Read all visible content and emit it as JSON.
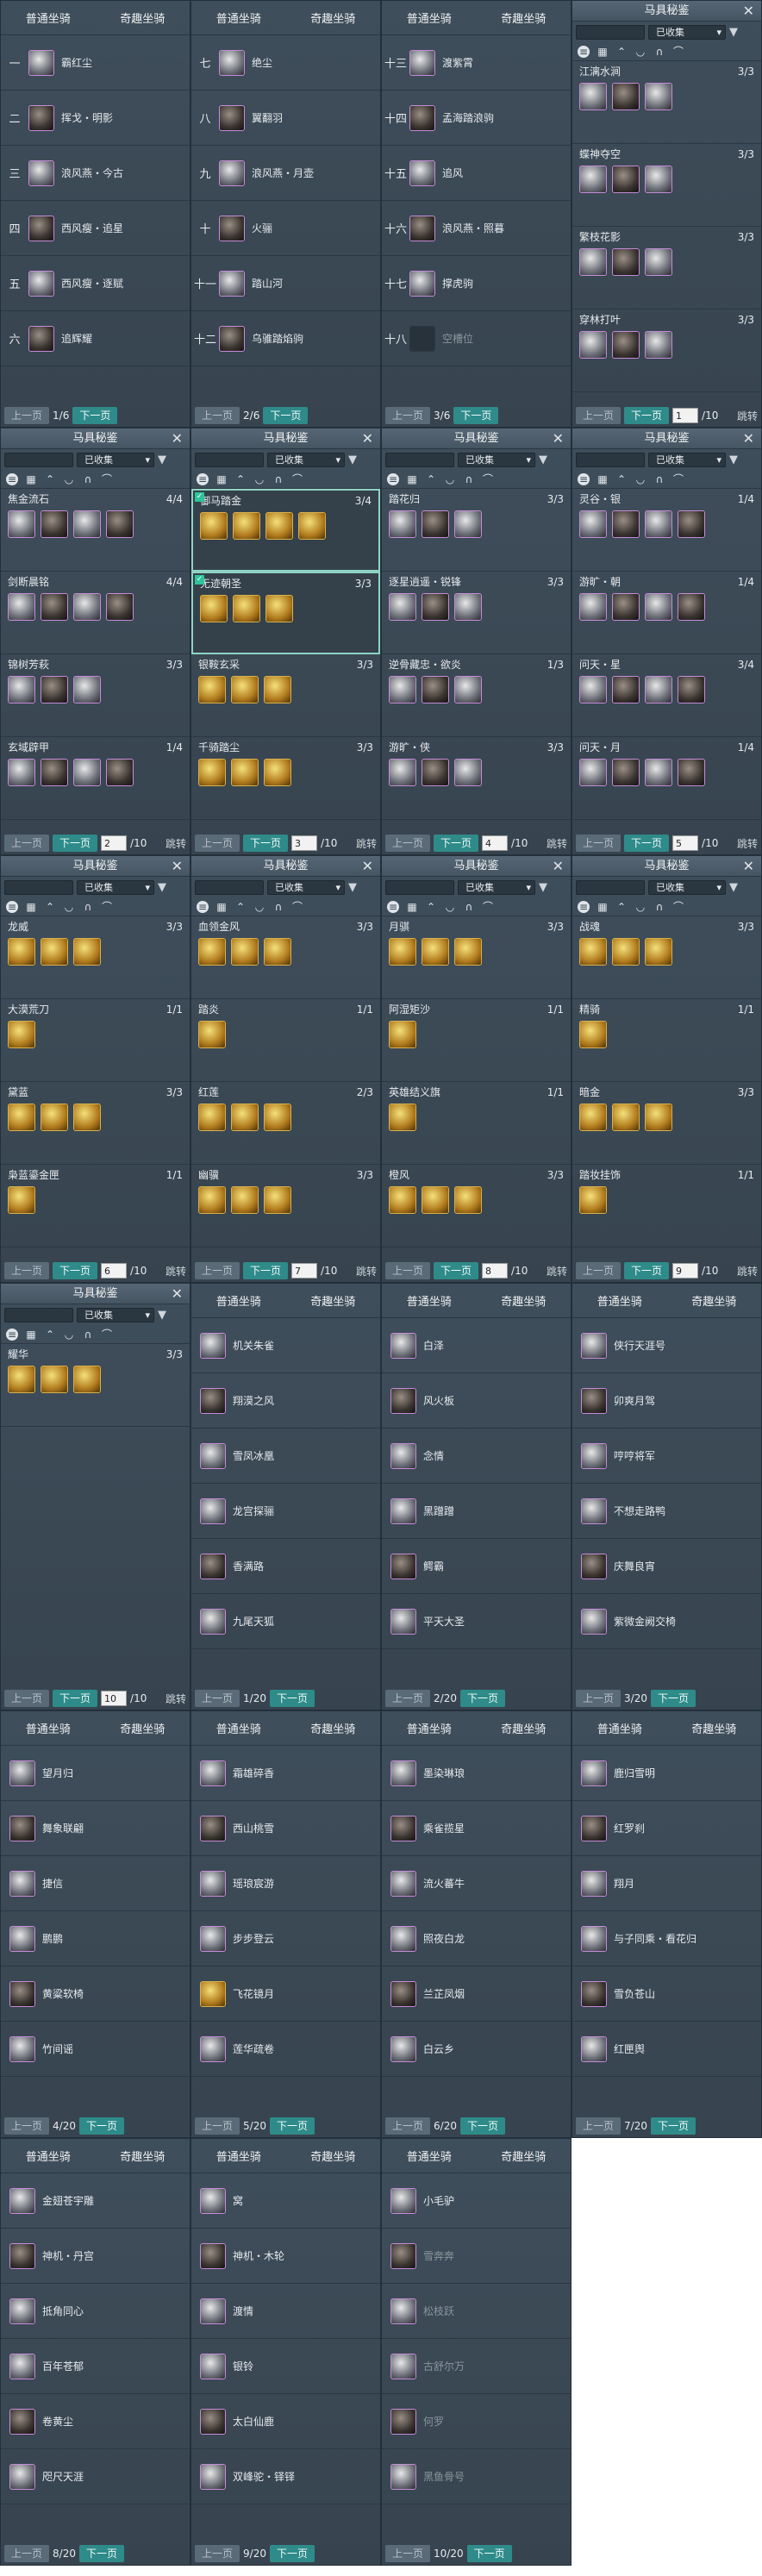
{
  "tabs": {
    "normal": "普通坐骑",
    "fun": "奇趣坐骑"
  },
  "btn": {
    "prev": "上一页",
    "next": "下一页",
    "jump": "跳转"
  },
  "gear": {
    "title": "马具秘鉴",
    "filter": "已收集"
  },
  "mounts": [
    {
      "page": "1/6",
      "rows": [
        [
          "一",
          "霸红尘"
        ],
        [
          "二",
          "挥戈・明影"
        ],
        [
          "三",
          "浪风燕・今古"
        ],
        [
          "四",
          "西风瘦・追星"
        ],
        [
          "五",
          "西风瘦・逐赋"
        ],
        [
          "六",
          "追辉耀"
        ]
      ]
    },
    {
      "page": "2/6",
      "rows": [
        [
          "七",
          "绝尘"
        ],
        [
          "八",
          "翼翻羽"
        ],
        [
          "九",
          "浪风燕・月壶"
        ],
        [
          "十",
          "火骊"
        ],
        [
          "十一",
          "踏山河"
        ],
        [
          "十二",
          "乌骓踏焰驹"
        ]
      ]
    },
    {
      "page": "3/6",
      "rows": [
        [
          "十三",
          "渡紫霄"
        ],
        [
          "十四",
          "孟海踏浪驹"
        ],
        [
          "十五",
          "追风"
        ],
        [
          "十六",
          "浪风燕・照暮"
        ],
        [
          "十七",
          "撑虎驹"
        ],
        [
          "十八",
          "空槽位"
        ]
      ]
    }
  ],
  "gearpanels": [
    {
      "page": "1",
      "items": [
        [
          "江漓水涧",
          "3/3",
          3
        ],
        [
          "蝶神夺空",
          "3/3",
          3
        ],
        [
          "繁枝花影",
          "3/3",
          3
        ],
        [
          "穿林打叶",
          "3/3",
          3
        ]
      ]
    },
    {
      "page": "2",
      "items": [
        [
          "焦金流石",
          "4/4",
          4
        ],
        [
          "剑断晨铭",
          "4/4",
          4
        ],
        [
          "锦树芳萩",
          "3/3",
          3
        ],
        [
          "玄域辟甲",
          "1/4",
          4
        ]
      ]
    },
    {
      "page": "3",
      "items": [
        [
          "御马踏金",
          "3/4",
          4
        ],
        [
          "无迹朝圣",
          "3/3",
          3
        ],
        [
          "银鞍玄采",
          "3/3",
          3
        ],
        [
          "千骑踏尘",
          "3/3",
          3
        ]
      ]
    },
    {
      "page": "4",
      "items": [
        [
          "踏花归",
          "3/3",
          3
        ],
        [
          "逐星逍遥・锐锋",
          "3/3",
          3
        ],
        [
          "逆骨藏忠・欲炎",
          "1/3",
          3
        ],
        [
          "游旷・侠",
          "3/3",
          3
        ]
      ]
    },
    {
      "page": "5",
      "items": [
        [
          "灵谷・银",
          "1/4",
          4
        ],
        [
          "游旷・朝",
          "1/4",
          4
        ],
        [
          "问天・星",
          "3/4",
          4
        ],
        [
          "问天・月",
          "1/4",
          4
        ]
      ]
    },
    {
      "page": "6",
      "items": [
        [
          "龙威",
          "3/3",
          3
        ],
        [
          "大漠荒刀",
          "1/1",
          1
        ],
        [
          "黛蓝",
          "3/3",
          3
        ],
        [
          "枭蓝鎏金匣",
          "1/1",
          1
        ]
      ]
    },
    {
      "page": "7",
      "items": [
        [
          "血领金风",
          "3/3",
          3
        ],
        [
          "踏炎",
          "1/1",
          1
        ],
        [
          "红莲",
          "2/3",
          3
        ],
        [
          "幽骥",
          "3/3",
          3
        ]
      ]
    },
    {
      "page": "8",
      "items": [
        [
          "月骐",
          "3/3",
          3
        ],
        [
          "阿湿矩沙",
          "1/1",
          1
        ],
        [
          "英雄结义旗",
          "1/1",
          1
        ],
        [
          "橙风",
          "3/3",
          3
        ]
      ]
    },
    {
      "page": "9",
      "items": [
        [
          "战魂",
          "3/3",
          3
        ],
        [
          "精骑",
          "1/1",
          1
        ],
        [
          "暗金",
          "3/3",
          3
        ],
        [
          "踏妆挂饰",
          "1/1",
          1
        ]
      ]
    },
    {
      "page": "10",
      "items": [
        [
          "耀华",
          "3/3",
          3
        ]
      ]
    }
  ],
  "fun": [
    {
      "page": "1/20",
      "rows": [
        "机关朱雀",
        "翔漠之风",
        "雪凤冰凰",
        "龙宫探骊",
        "香满路",
        "九尾天狐"
      ]
    },
    {
      "page": "2/20",
      "rows": [
        "白泽",
        "风火板",
        "念情",
        "黑蹭蹭",
        "鳄霸",
        "平天大圣"
      ]
    },
    {
      "page": "3/20",
      "rows": [
        "侠行天涯号",
        "卯爽月驾",
        "哼哼将军",
        "不想走路鸭",
        "庆舞良宵",
        "紫微金阙交椅"
      ]
    },
    {
      "page": "4/20",
      "rows": [
        "望月归",
        "舞象联翩",
        "捷信",
        "鹏鹏",
        "黄粱软椅",
        "竹间谣"
      ]
    },
    {
      "page": "5/20",
      "rows": [
        "霜雄碎香",
        "西山桃雪",
        "瑶琅宸游",
        "步步登云",
        "飞花镜月",
        "莲华疏卷"
      ]
    },
    {
      "page": "6/20",
      "rows": [
        "墨染琳琅",
        "乘雀揽星",
        "流火蕃牛",
        "照夜白龙",
        "兰芷凤烟",
        "白云乡"
      ]
    },
    {
      "page": "7/20",
      "rows": [
        "鹿归雪明",
        "红罗刹",
        "翔月",
        "与子同乘・看花归",
        "雪负苍山",
        "红匣舆"
      ]
    },
    {
      "page": "8/20",
      "rows": [
        "金翅苍宇雕",
        "神机・丹宫",
        "抵角同心",
        "百年苍郁",
        "卷黄尘",
        "咫尺天涯"
      ]
    },
    {
      "page": "9/20",
      "rows": [
        "窝",
        "神机・木轮",
        "渡情",
        "银铃",
        "太白仙鹿",
        "双峰驼・铎铎"
      ]
    },
    {
      "page": "10/20",
      "rows": [
        "小毛驴",
        "雪奔奔",
        "松枝跃",
        "古舒尔万",
        "何罗",
        "黑鱼骨号"
      ]
    }
  ]
}
